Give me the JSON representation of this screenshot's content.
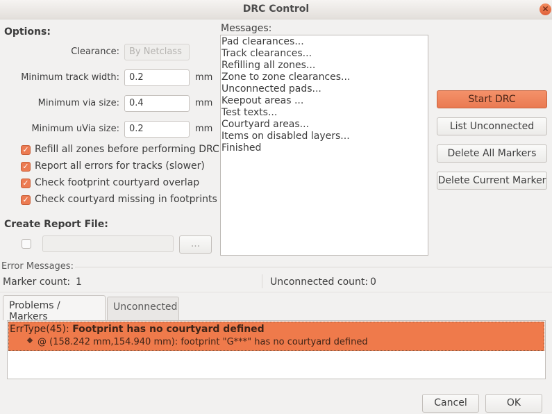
{
  "window": {
    "title": "DRC Control",
    "close_icon": "close-icon"
  },
  "options": {
    "heading": "Options:",
    "clearance": {
      "label": "Clearance:",
      "value": "By Netclass"
    },
    "min_track_width": {
      "label": "Minimum track width:",
      "value": "0.2",
      "unit": "mm"
    },
    "min_via_size": {
      "label": "Minimum via size:",
      "value": "0.4",
      "unit": "mm"
    },
    "min_uvia_size": {
      "label": "Minimum uVia size:",
      "value": "0.2",
      "unit": "mm"
    },
    "checkboxes": [
      {
        "label": "Refill all zones before performing DRC",
        "checked": true
      },
      {
        "label": "Report all errors for tracks (slower)",
        "checked": true
      },
      {
        "label": "Check footprint courtyard overlap",
        "checked": true
      },
      {
        "label": "Check courtyard missing in footprints",
        "checked": true
      }
    ]
  },
  "report": {
    "heading": "Create Report File:",
    "checked": false,
    "path": "",
    "browse_label": "..."
  },
  "messages": {
    "label": "Messages:",
    "lines": [
      "Pad clearances...",
      "Track clearances...",
      "Refilling all zones...",
      "Zone to zone clearances...",
      "Unconnected pads...",
      "Keepout areas ...",
      "Test texts...",
      "Courtyard areas...",
      "Items on disabled layers...",
      "Finished"
    ]
  },
  "actions": {
    "start_drc": "Start DRC",
    "list_unconnected": "List Unconnected",
    "delete_all_markers": "Delete All Markers",
    "delete_current_marker": "Delete Current Marker"
  },
  "errors": {
    "label": "Error Messages:",
    "marker_count_label": "Marker count:",
    "marker_count": "1",
    "unconnected_count_label": "Unconnected count:",
    "unconnected_count": "0",
    "tabs": [
      "Problems / Markers",
      "Unconnected"
    ],
    "items": [
      {
        "type": "ErrType(45): ",
        "title": "Footprint has no courtyard defined",
        "detail": "@ (158.242 mm,154.940 mm): footprint \"G***\" has no courtyard defined"
      }
    ]
  },
  "footer": {
    "cancel": "Cancel",
    "ok": "OK"
  },
  "colors": {
    "accent": "#ef7a4b"
  }
}
